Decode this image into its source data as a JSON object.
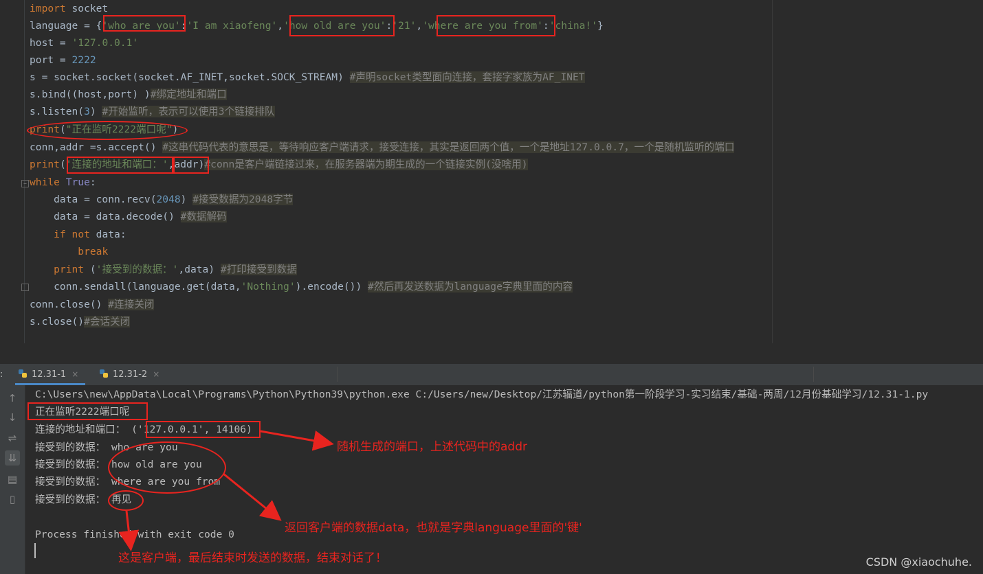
{
  "code": {
    "line1": {
      "kw": "import",
      "rest": " socket"
    },
    "line2": {
      "prefix": "language = {",
      "k1": "'who are you'",
      "c1": ":",
      "v1": "'I am xiaofeng'",
      "s1": ",",
      "k2": "'how old are you'",
      "c2": ":",
      "v2": "'21'",
      "s2": ",",
      "k3": "'where are you from'",
      "c3": ":",
      "v3": "'china!'",
      "suffix": "}"
    },
    "line3": {
      "prefix": "host = ",
      "value": "'127.0.0.1'"
    },
    "line4": {
      "prefix": "port = ",
      "value": "2222"
    },
    "line5": {
      "code": "s = socket.socket(socket.AF_INET,socket.SOCK_STREAM) ",
      "comment": "#声明socket类型面向连接，套接字家族为AF_INET"
    },
    "line6": {
      "code": "s.bind((host,port) )",
      "comment": "#绑定地址和端口"
    },
    "line7": {
      "code_a": "s.listen(",
      "num": "3",
      "code_b": ") ",
      "comment": "#开始监听，表示可以使用3个链接排队"
    },
    "line8": {
      "fn": "print",
      "open": "(",
      "str": "\"正在监听2222端口呢\"",
      "close": ")"
    },
    "line9": {
      "code": "conn,addr =s.accept() ",
      "comment": "#这串代码代表的意思是，等待响应客户端请求，接受连接，其实是返回两个值，一个是地址127.0.0.7，一个是随机监听的端口"
    },
    "line10": {
      "fn": "print",
      "open": "(",
      "str": "'连接的地址和端口：'",
      "rest": ",addr)",
      "comment": "#conn是客户端链接过来，在服务器端为期生成的一个链接实例(没啥用)"
    },
    "line11": {
      "kw": "while",
      "sp": " ",
      "val": "True",
      "rest": ":"
    },
    "line12": {
      "code_a": "    data = conn.recv(",
      "num": "2048",
      "code_b": ") ",
      "comment": "#接受数据为2048字节"
    },
    "line13": {
      "code": "    data = data.decode() ",
      "comment": "#数据解码"
    },
    "line14": {
      "indent": "    ",
      "kw1": "if",
      "mid": " ",
      "kw2": "not",
      "rest": " data:"
    },
    "line15": {
      "indent": "        ",
      "kw": "break"
    },
    "line16": {
      "indent": "    ",
      "fn": "print",
      "open": " (",
      "str": "'接受到的数据：'",
      "rest": ",data) ",
      "comment": "#打印接受到数据"
    },
    "line17": {
      "code_a": "    conn.sendall(language.get(data,",
      "str": "'Nothing'",
      "code_b": ").encode()) ",
      "comment": "#然后再发送数据为language字典里面的内容"
    },
    "line18": {
      "code": "conn.close() ",
      "comment": "#连接关闭"
    },
    "line19": {
      "code": "s.close()",
      "comment": "#会话关闭"
    }
  },
  "tabs": [
    {
      "label": "12.31-1",
      "close": "×"
    },
    {
      "label": "12.31-2",
      "close": "×"
    }
  ],
  "panel_marker": ":",
  "console": {
    "cmd": "C:\\Users\\new\\AppData\\Local\\Programs\\Python\\Python39\\python.exe C:/Users/new/Desktop/江苏辐道/python第一阶段学习-实习结束/基础-两周/12月份基础学习/12.31-1.py",
    "out1": "正在监听2222端口呢",
    "out2_label": "连接的地址和端口： ",
    "out2_value": "('127.0.0.1', 14106)",
    "recv_label": "接受到的数据： ",
    "recv1": "who are you",
    "recv2": "how old are you",
    "recv3": "where are you from",
    "recv4": "再见",
    "finished": "Process finished with exit code 0"
  },
  "annotations": {
    "a1": "随机生成的端口，上述代码中的addr",
    "a2": "返回客户端的数据data，也就是字典language里面的'键'",
    "a3": "这是客户端，最后结束时发送的数据，结束对话了！"
  },
  "watermark": "CSDN @xiaochuhe.",
  "colors": {
    "annotation": "#e8241f",
    "background": "#2b2b2b",
    "tab_accent": "#4a88c7"
  },
  "icons": [
    "python-file-icon",
    "scroll-up-icon",
    "scroll-down-icon",
    "soft-wrap-icon",
    "scroll-to-end-icon",
    "print-icon",
    "trash-icon"
  ]
}
